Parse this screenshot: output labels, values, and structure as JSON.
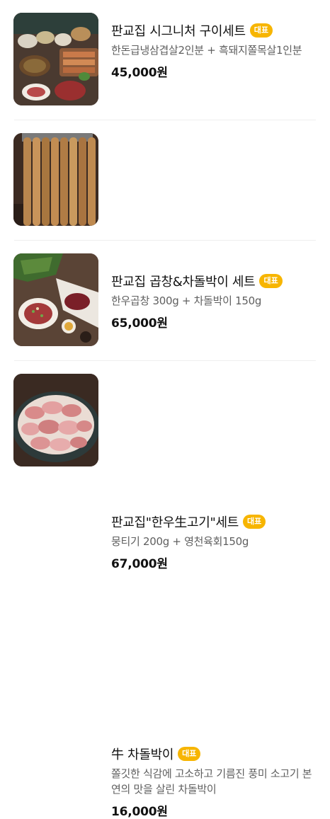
{
  "menu": {
    "items": [
      {
        "name": "판교집 시그니처 구이세트",
        "badge": "대표",
        "description": "한돈급냉삼겹살2인분 + 흑돼지쫄목살1인분",
        "price": "45,000원"
      },
      {
        "name": "판교집 곱창&차돌박이 세트",
        "badge": "대표",
        "description": "한우곱창 300g + 차돌박이 150g",
        "price": "65,000원"
      },
      {
        "name": "판교집\"한우生고기\"세트",
        "badge": "대표",
        "description": "뭉티기 200g + 영천육회150g",
        "price": "67,000원"
      },
      {
        "name": "牛 차돌박이",
        "badge": "대표",
        "description": "쫄깃한 식감에 고소하고 기름진 풍미 소고기 본연의 맛을 살린 차돌박이",
        "price": "16,000원"
      }
    ]
  }
}
